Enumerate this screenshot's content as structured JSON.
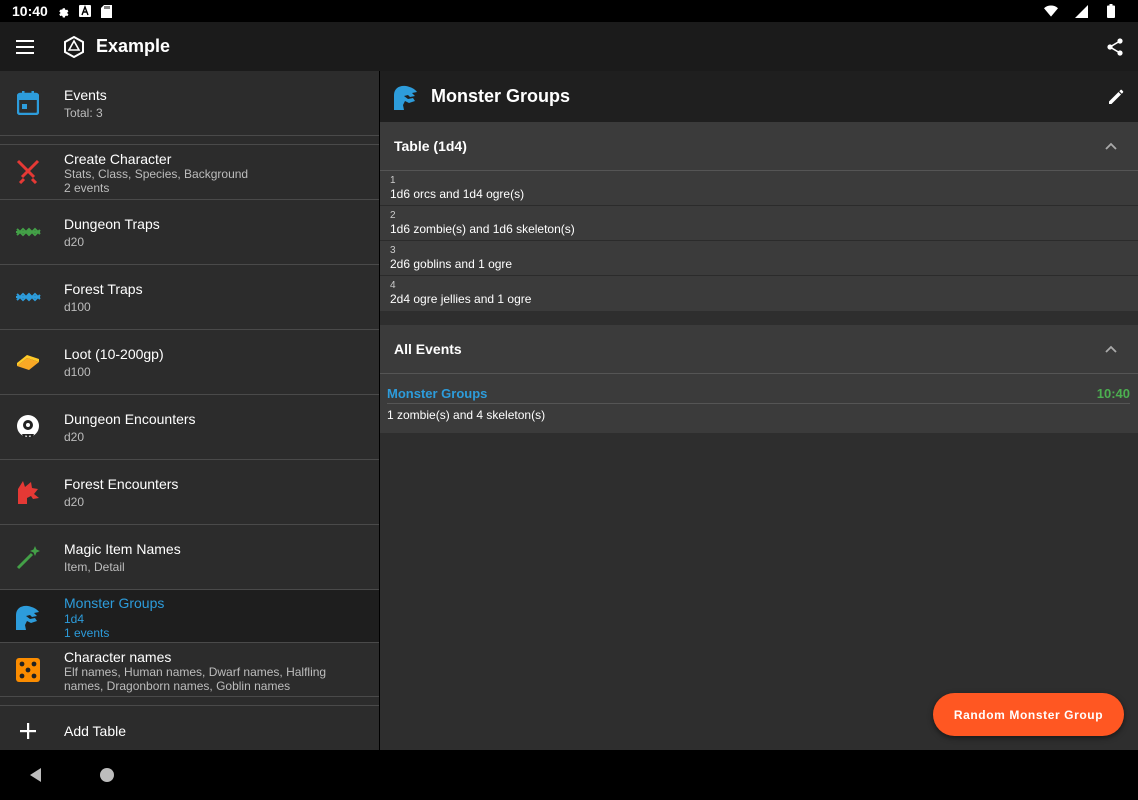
{
  "status": {
    "time": "10:40"
  },
  "app": {
    "title": "Example"
  },
  "sidebar": {
    "items": [
      {
        "name": "Events",
        "sub": "Total: 3"
      },
      {
        "name": "Create Character",
        "sub": "Stats, Class, Species, Background",
        "sub2": "2 events"
      },
      {
        "name": "Dungeon Traps",
        "sub": "d20"
      },
      {
        "name": "Forest Traps",
        "sub": "d100"
      },
      {
        "name": "Loot (10-200gp)",
        "sub": "d100"
      },
      {
        "name": "Dungeon Encounters",
        "sub": "d20"
      },
      {
        "name": "Forest Encounters",
        "sub": "d20"
      },
      {
        "name": "Magic Item Names",
        "sub": "Item, Detail"
      },
      {
        "name": "Monster Groups",
        "sub": "1d4",
        "sub2": "1 events"
      },
      {
        "name": "Character names",
        "sub": "Elf names, Human names, Dwarf names, Halfling",
        "sub2": "names, Dragonborn names, Goblin names"
      }
    ],
    "add_label": "Add Table"
  },
  "main": {
    "title": "Monster Groups",
    "table": {
      "label": "Table (1d4)",
      "rows": [
        {
          "num": "1",
          "text": "1d6 orcs and 1d4 ogre(s)"
        },
        {
          "num": "2",
          "text": "1d6 zombie(s) and 1d6 skeleton(s)"
        },
        {
          "num": "3",
          "text": "2d6 goblins and 1 ogre"
        },
        {
          "num": "4",
          "text": "2d4 ogre jellies and 1 ogre"
        }
      ]
    },
    "events": {
      "label": "All Events",
      "items": [
        {
          "name": "Monster Groups",
          "time": "10:40",
          "desc": "1 zombie(s) and 4 skeleton(s)"
        }
      ]
    },
    "fab_label": "Random Monster Group"
  },
  "colors": {
    "accent": "#2d9cdb",
    "fab": "#ff5722",
    "time": "#4caf50"
  },
  "icons": [
    "menu-icon",
    "d20-logo-icon",
    "share-icon",
    "calendar-icon",
    "crossed-swords-icon",
    "bear-trap-icon",
    "gold-bar-icon",
    "cyclops-icon",
    "dragon-head-icon",
    "magic-wand-icon",
    "hydra-icon",
    "dice-icon",
    "plus-icon",
    "pencil-icon",
    "chevron-up-icon"
  ]
}
